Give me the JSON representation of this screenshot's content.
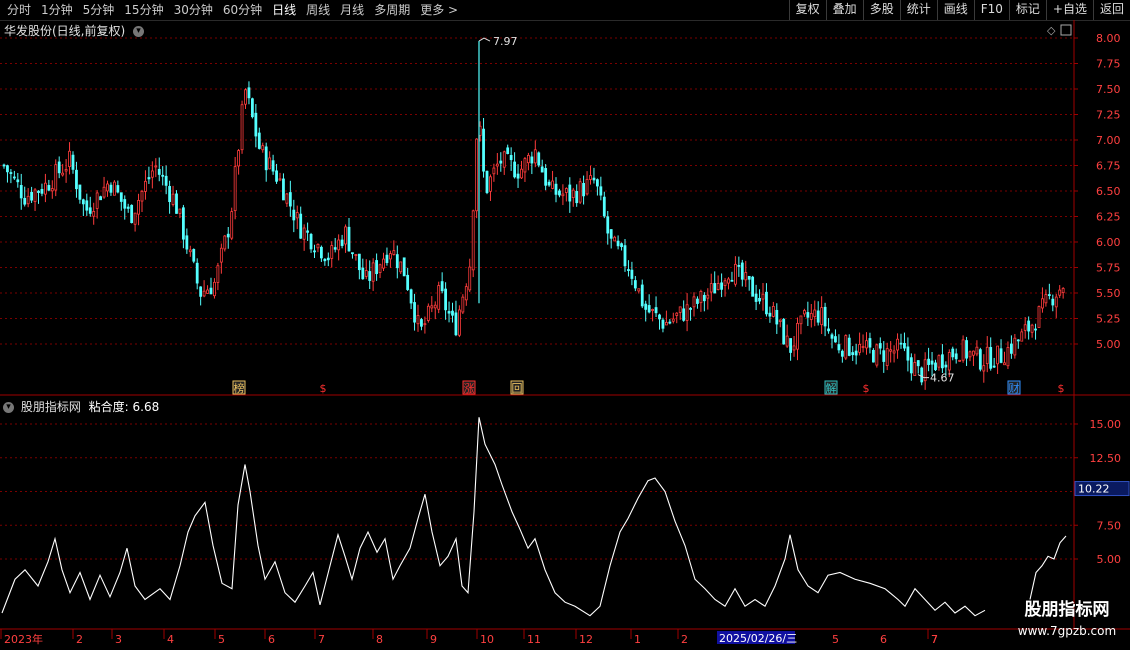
{
  "toolbar": {
    "periods": [
      "分时",
      "1分钟",
      "5分钟",
      "15分钟",
      "30分钟",
      "60分钟",
      "日线",
      "周线",
      "月线",
      "多周期",
      "更多 >"
    ],
    "active_period": "日线",
    "actions": [
      "复权",
      "叠加",
      "多股",
      "统计",
      "画线",
      "F10",
      "标记",
      "+自选",
      "返回"
    ]
  },
  "main_chart": {
    "title": "华发股份(日线,前复权)",
    "y_ticks": [
      "8.00",
      "7.75",
      "7.50",
      "7.25",
      "7.00",
      "6.75",
      "6.50",
      "6.25",
      "6.00",
      "5.75",
      "5.50",
      "5.25",
      "5.00"
    ],
    "high_label": "7.97",
    "low_label": "4.67",
    "markers": [
      {
        "text": "榜",
        "color": "#e8c060"
      },
      {
        "text": "$",
        "color": "#ff3030"
      },
      {
        "text": "涨",
        "color": "#ff3030"
      },
      {
        "text": "回",
        "color": "#e8c060"
      },
      {
        "text": "解",
        "color": "#30c0c0"
      },
      {
        "text": "$",
        "color": "#ff3030"
      },
      {
        "text": "财",
        "color": "#3090ff"
      },
      {
        "text": "$",
        "color": "#ff3030"
      }
    ]
  },
  "indicator": {
    "name": "股朋指标网",
    "value_label": "粘合度: 6.68",
    "y_ticks": [
      "15.00",
      "12.50",
      "10.00",
      "7.50",
      "5.00"
    ],
    "current_value": "10.22"
  },
  "x_axis": {
    "labels": [
      "2023年",
      "2",
      "3",
      "4",
      "5",
      "6",
      "7",
      "8",
      "9",
      "10",
      "11",
      "12",
      "1",
      "2",
      "7"
    ],
    "cursor_date": "2025/02/26/三",
    "labels_after": [
      "5",
      "6",
      "7"
    ]
  },
  "brand": {
    "line1": "股朋指标网",
    "line2": "www.7gpzb.com"
  },
  "colors": {
    "up": "#ff3c3c",
    "down": "#54ffff",
    "grid": "#7a0000",
    "axis": "#a00000",
    "tick_text": "#ff4040"
  }
}
